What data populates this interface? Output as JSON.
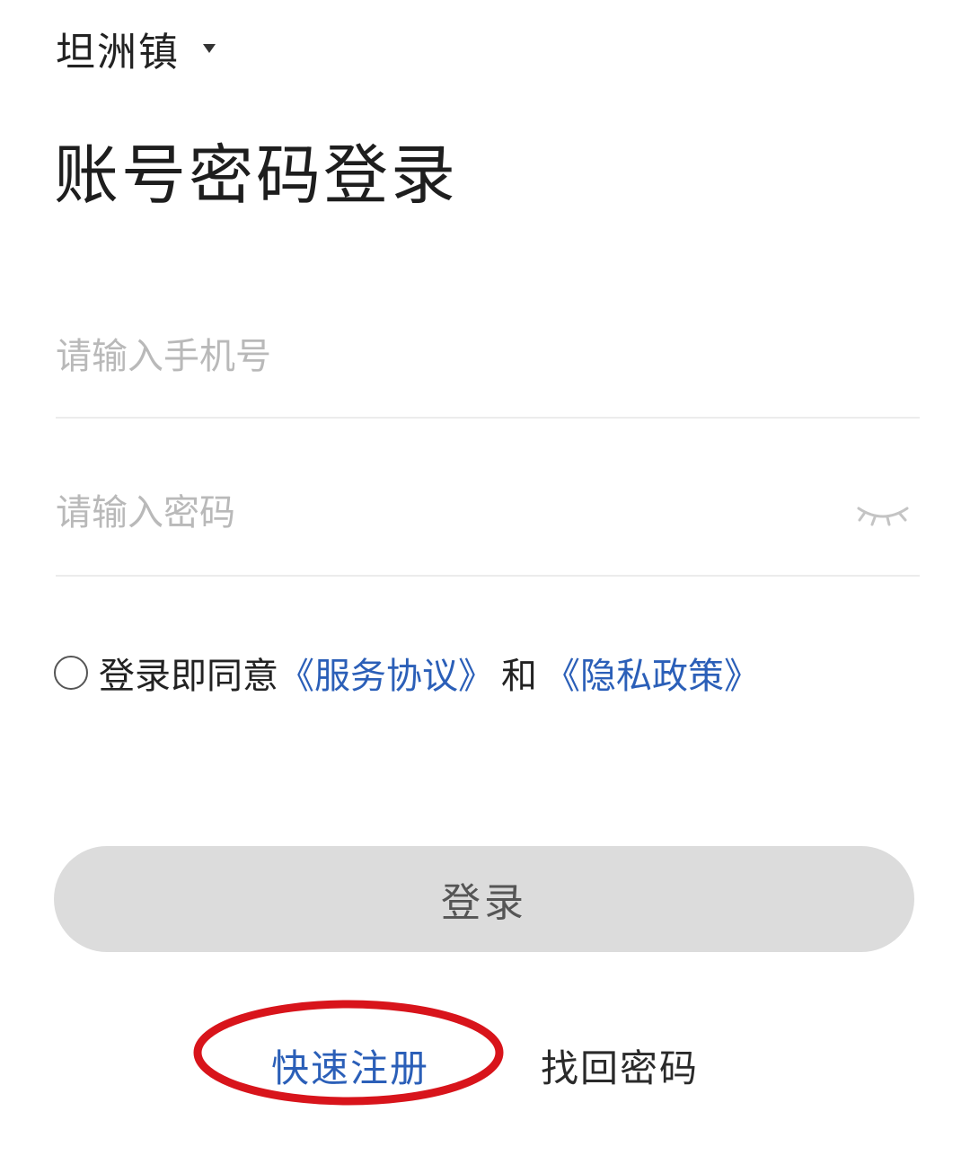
{
  "header": {
    "region": "坦洲镇",
    "region_dropdown_icon": "caret-down-icon"
  },
  "title": "账号密码登录",
  "form": {
    "phone_placeholder": "请输入手机号",
    "password_placeholder": "请输入密码",
    "password_toggle_icon": "eye-closed-icon"
  },
  "agreement": {
    "checked": false,
    "prefix": "登录即同意",
    "service_link": "《服务协议》",
    "and": "和",
    "privacy_link": "《隐私政策》"
  },
  "login_button": "登录",
  "footer": {
    "register": "快速注册",
    "forgot_password": "找回密码"
  },
  "colors": {
    "link": "#2b5fb8",
    "button_bg": "#dcdcdc",
    "annotation": "#d8141b"
  }
}
